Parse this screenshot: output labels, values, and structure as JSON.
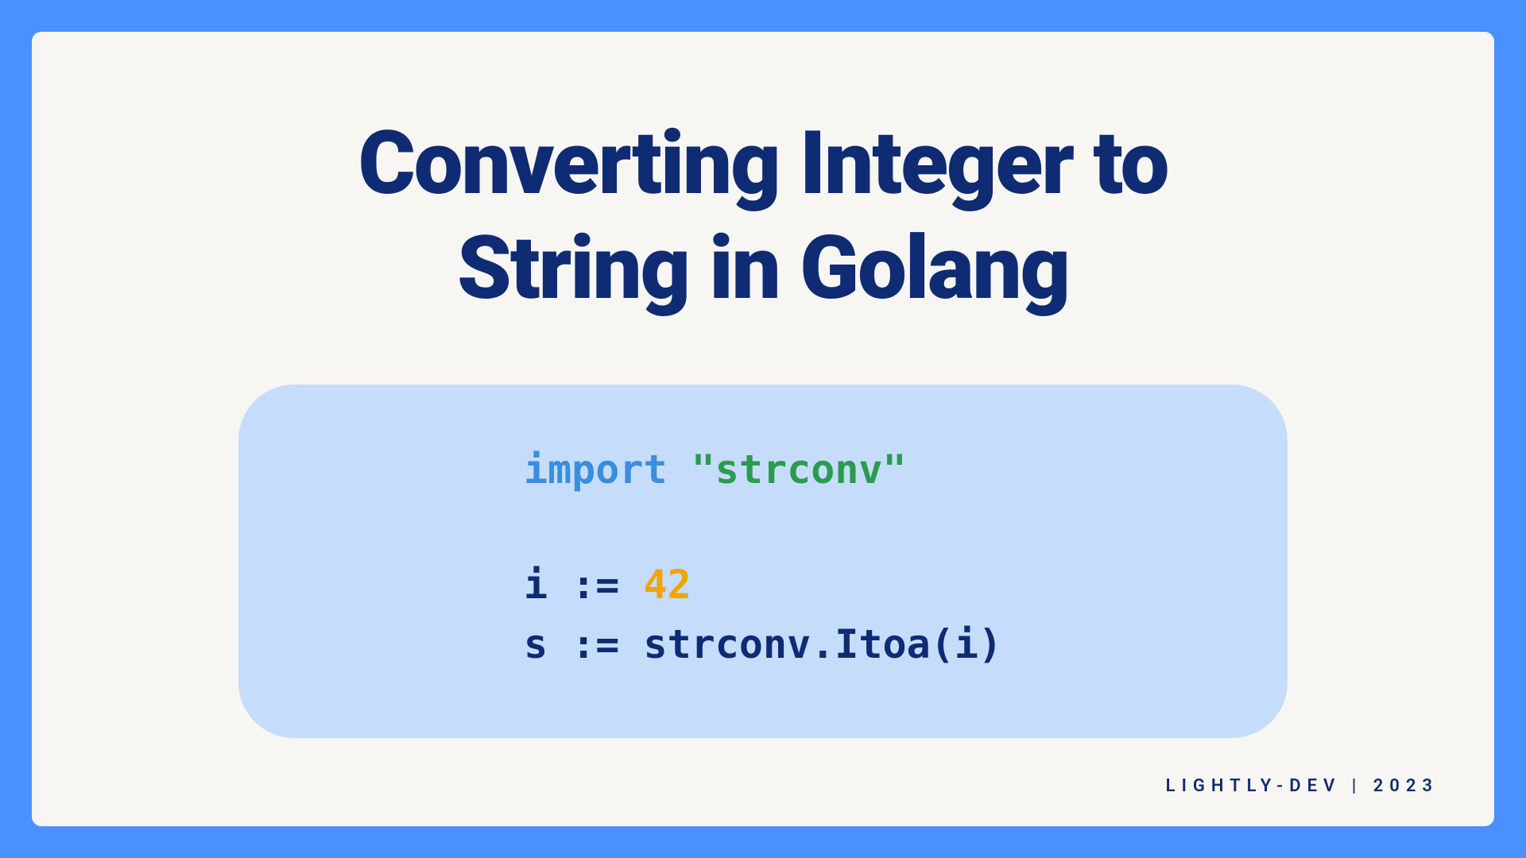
{
  "title_line1": "Converting Integer to",
  "title_line2": "String in Golang",
  "code": {
    "import_kw": "import",
    "import_sp": " ",
    "import_str": "\"strconv\"",
    "line2_a": "i := ",
    "line2_num": "42",
    "line3": "s := strconv.Itoa(i)"
  },
  "footer": "LIGHTLY-DEV | 2023"
}
